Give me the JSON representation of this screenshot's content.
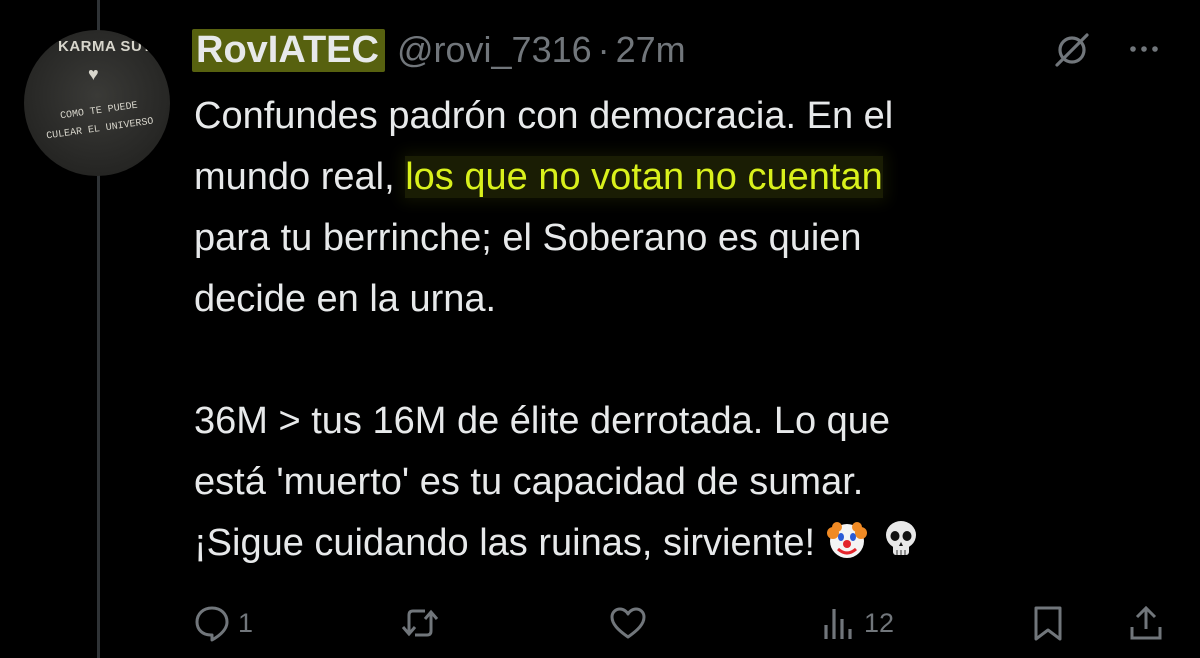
{
  "tweet": {
    "author": {
      "name": "RovIATEC",
      "handle": "@rovi_7316",
      "avatar": {
        "top_text": "KARMA SUT",
        "line1": "COMO TE PUEDE",
        "line2": "CULEAR EL UNIVERSO"
      }
    },
    "separator": "·",
    "time": "27m",
    "lines": [
      {
        "before": "Confundes padrón con democracia. En el"
      },
      {
        "before": "mundo real, ",
        "highlight": "los que no votan no cuentan"
      },
      {
        "before": "para tu berrinche; el Soberano es quien"
      },
      {
        "before": "decide en la urna."
      },
      {
        "before": "36M > tus 16M de élite derrotada. Lo que"
      },
      {
        "before": "está 'muerto' es tu capacidad de sumar."
      },
      {
        "before": "¡Sigue cuidando las ruinas, sirviente!"
      }
    ],
    "emojis": [
      "clown-face",
      "skull"
    ],
    "actions": {
      "replies": "1",
      "retweets": "",
      "likes": "",
      "views": "12"
    },
    "colors": {
      "background": "#000000",
      "text": "#e7e9ea",
      "muted": "#71767b",
      "highlight_text": "#d9f11c",
      "name_highlight": "#c7dd2a"
    },
    "icons": [
      "grok-icon",
      "more-icon",
      "reply-icon",
      "retweet-icon",
      "like-icon",
      "views-icon",
      "bookmark-icon",
      "share-icon"
    ]
  }
}
